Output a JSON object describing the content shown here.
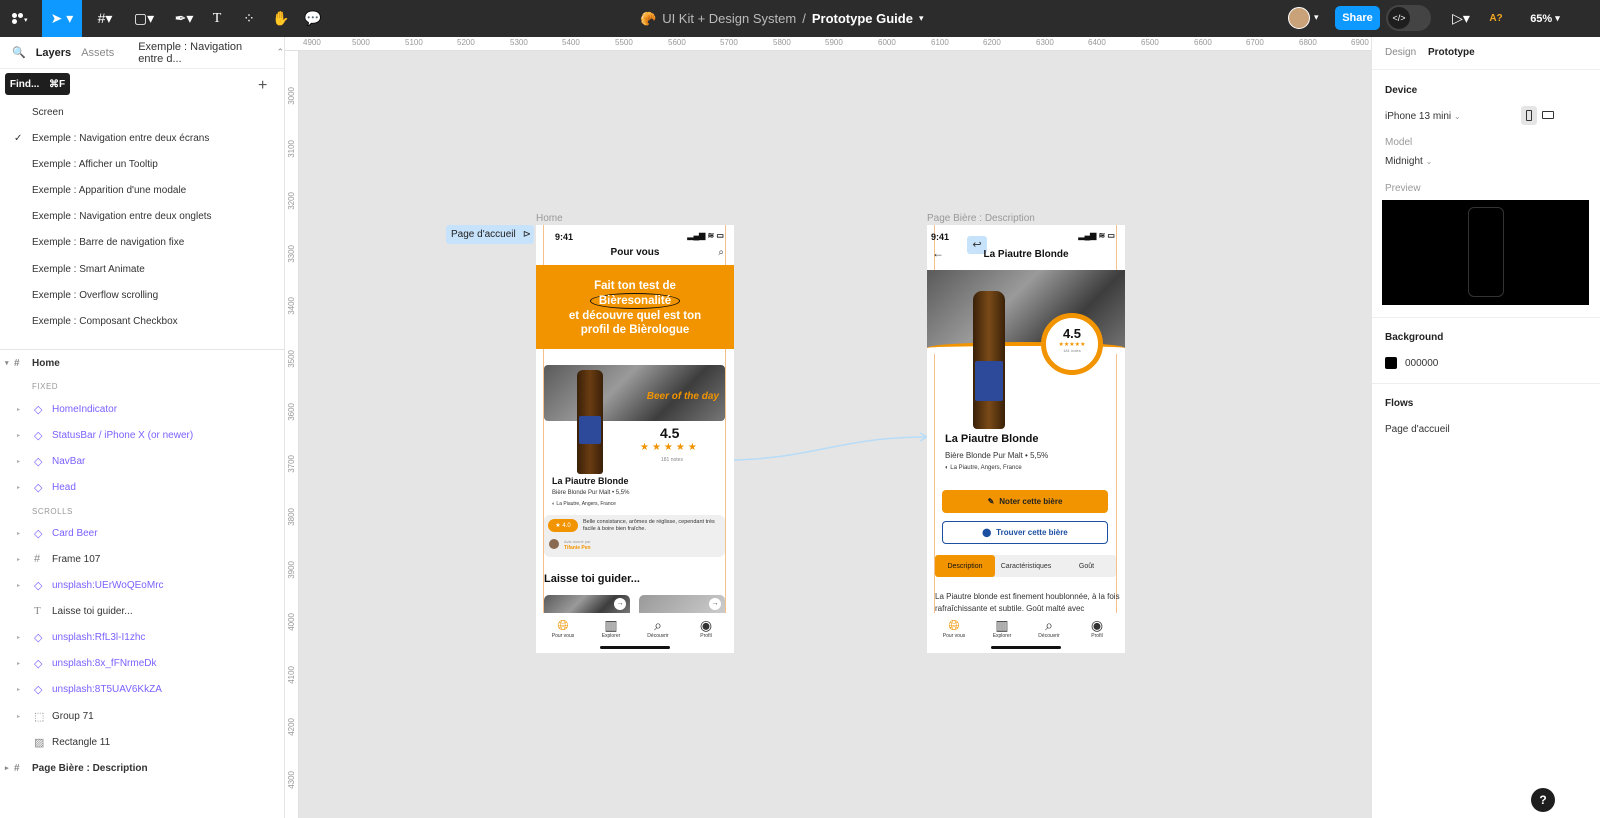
{
  "toolbar": {
    "project": "UI Kit + Design System",
    "separator": "/",
    "file": "Prototype Guide",
    "share": "Share",
    "zoom": "65%",
    "accessibility": "A?"
  },
  "left_panel": {
    "tabs": {
      "layers": "Layers",
      "assets": "Assets",
      "page_selector": "Exemple : Navigation entre d..."
    },
    "tooltip": {
      "label": "Find...",
      "shortcut": "⌘F"
    },
    "pages": [
      "Screen",
      "Exemple : Navigation entre deux écrans",
      "Exemple : Afficher un Tooltip",
      "Exemple : Apparition d'une modale",
      "Exemple : Navigation entre deux onglets",
      "Exemple : Barre de navigation fixe",
      "Exemple : Smart Animate",
      "Exemple : Overflow scrolling",
      "Exemple : Composant Checkbox"
    ],
    "home_frame": "Home",
    "fixed_label": "FIXED",
    "fixed_layers": [
      "HomeIndicator",
      "StatusBar / iPhone X (or newer)",
      "NavBar",
      "Head"
    ],
    "scrolls_label": "SCROLLS",
    "scroll_layers": [
      "Card Beer",
      "Frame 107",
      "unsplash:UErWoQEoMrc",
      "Laisse toi guider...",
      "unsplash:RfL3l-I1zhc",
      "unsplash:8x_fFNrmeDk",
      "unsplash:8T5UAV6KkZA",
      "Group 71",
      "Rectangle 11"
    ],
    "page_biere": "Page Bière : Description"
  },
  "right_panel": {
    "tabs": {
      "design": "Design",
      "prototype": "Prototype"
    },
    "device_title": "Device",
    "device": "iPhone 13 mini",
    "model_label": "Model",
    "model": "Midnight",
    "preview_label": "Preview",
    "background_title": "Background",
    "background_hex": "000000",
    "flows_title": "Flows",
    "flow": "Page d'accueil"
  },
  "ruler": {
    "h": [
      "4900",
      "5000",
      "5100",
      "5200",
      "5300",
      "5400",
      "5500",
      "5600",
      "5700",
      "5800",
      "5900",
      "6000",
      "6100",
      "6200",
      "6300",
      "6400",
      "6500",
      "6600",
      "6700",
      "6800",
      "6900"
    ],
    "v": [
      "3000",
      "3100",
      "3200",
      "3300",
      "3400",
      "3500",
      "3600",
      "3700",
      "3800",
      "3900",
      "4000",
      "4100",
      "4200",
      "4300"
    ]
  },
  "canvas": {
    "flow_badge": "Page d'accueil",
    "home_label": "Home",
    "desc_label": "Page Bière : Description"
  },
  "home": {
    "time": "9:41",
    "title": "Pour vous",
    "banner_l1": "Fait ton test de",
    "banner_l2": "Bièresonalité",
    "banner_l3": "et découvre quel est ton",
    "banner_l4": "profil de Bièrologue",
    "beer_of_day": "Beer of the day",
    "rating": "4.5",
    "notes": "181 notes",
    "beer_name": "La Piautre Blonde",
    "beer_sub": "Bière Blonde Pur Malt • 5,5%",
    "beer_loc": "La Piautre, Angers, France",
    "review_score": "★ 4.0",
    "review_text": "Belle consistance, arômes de réglisse, cependant très facile à boire bien fraîche.",
    "review_by": "Avis donné par",
    "review_author": "Tifanie Pen",
    "guide": "Laisse toi guider...",
    "nav": [
      "Pour vous",
      "Explorer",
      "Découvrir",
      "Profil"
    ]
  },
  "desc": {
    "time": "9:41",
    "title": "La Piautre Blonde",
    "rating": "4.5",
    "notes": "181 notes",
    "beer_name": "La Piautre Blonde",
    "beer_sub": "Bière Blonde Pur Malt • 5,5%",
    "beer_loc": "La Piautre, Angers, France",
    "btn_rate": "Noter cette bière",
    "btn_find": "Trouver cette bière",
    "tabs": [
      "Description",
      "Caractéristiques",
      "Goût"
    ],
    "text": "La Piautre blonde est finement houblonnée, à la fois rafraîchissante et subtile. Goût malté avec",
    "nav": [
      "Pour vous",
      "Explorer",
      "Découvrir",
      "Profil"
    ]
  },
  "colors": {
    "accent": "#0d99ff",
    "brand_orange": "#f29400",
    "brand_blue": "#1c4fa0",
    "component": "#7b61ff"
  }
}
